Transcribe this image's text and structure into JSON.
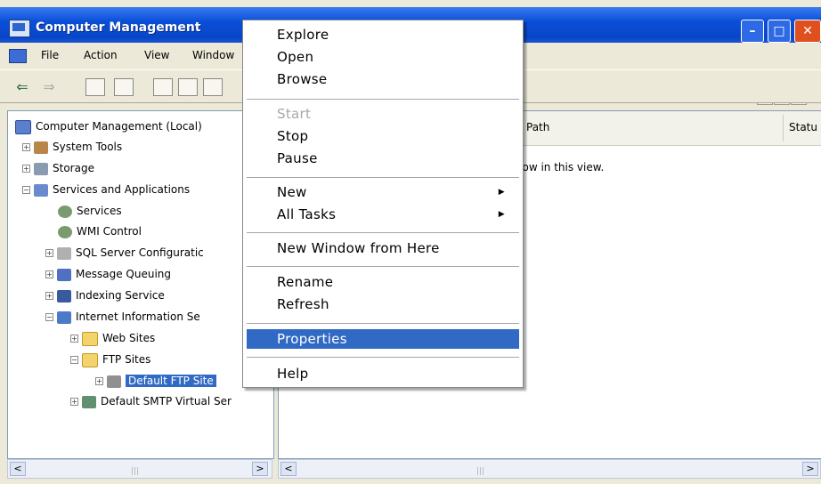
{
  "window": {
    "title": "Computer Management"
  },
  "menubar": {
    "items": [
      "File",
      "Action",
      "View",
      "Window"
    ]
  },
  "tree": {
    "root": "Computer Management (Local)",
    "system_tools": "System Tools",
    "storage": "Storage",
    "services_apps": "Services and Applications",
    "services": "Services",
    "wmi": "WMI Control",
    "sql": "SQL Server Configuratic",
    "msmq": "Message Queuing",
    "indexing": "Indexing Service",
    "iis": "Internet Information Se",
    "web_sites": "Web Sites",
    "ftp_sites": "FTP Sites",
    "default_ftp": "Default FTP Site",
    "default_smtp": "Default SMTP Virtual Ser"
  },
  "right_pane": {
    "col_path": "Path",
    "col_status": "Statu",
    "empty_message": "ms to show in this view."
  },
  "context_menu": {
    "explore": "Explore",
    "open": "Open",
    "browse": "Browse",
    "start": "Start",
    "stop": "Stop",
    "pause": "Pause",
    "new": "New",
    "all_tasks": "All Tasks",
    "new_window": "New Window from Here",
    "rename": "Rename",
    "refresh": "Refresh",
    "properties": "Properties",
    "help": "Help"
  },
  "colors": {
    "title_bar": "#0a4fd8",
    "selection": "#316ac5",
    "close_button": "#e0501e"
  }
}
